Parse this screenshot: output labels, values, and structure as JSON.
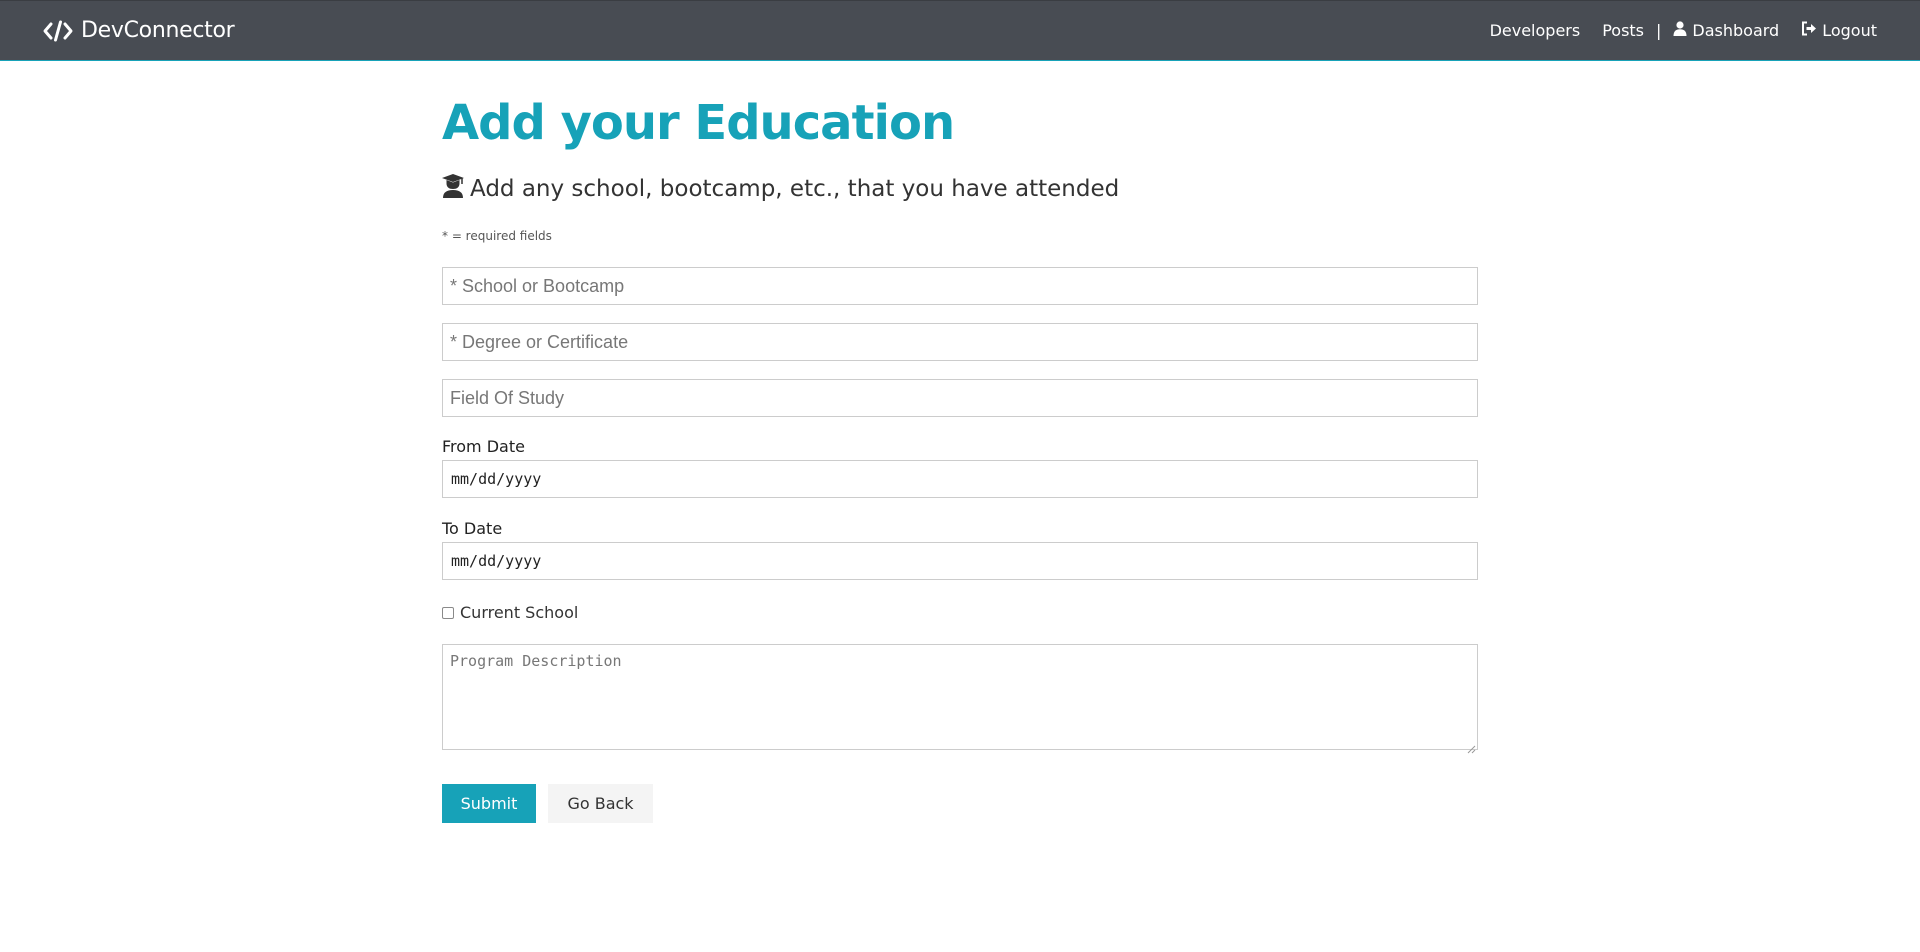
{
  "navbar": {
    "brand": "DevConnector",
    "brand_icon": "code-icon",
    "links": {
      "developers": "Developers",
      "posts": "Posts",
      "separator": "|",
      "dashboard": "Dashboard",
      "logout": "Logout"
    },
    "icons": {
      "dashboard": "user-icon",
      "logout": "sign-out-icon"
    },
    "colors": {
      "background": "#484c53",
      "accent": "#17a2b8"
    }
  },
  "page": {
    "title": "Add your Education",
    "lead": "Add any school, bootcamp, etc., that you have attended",
    "lead_icon": "graduation-cap-user-icon",
    "required_note": "* = required fields",
    "title_color": "#17a2b8"
  },
  "form": {
    "school_placeholder": "* School or Bootcamp",
    "degree_placeholder": "* Degree or Certificate",
    "field_of_study_placeholder": "Field Of Study",
    "from_date_label": "From Date",
    "from_date_value": "mm/dd/yyyy",
    "to_date_label": "To Date",
    "to_date_value": "mm/dd/yyyy",
    "current_label": "Current School",
    "current_checked": false,
    "description_placeholder": "Program Description",
    "submit_label": "Submit",
    "back_label": "Go Back"
  }
}
